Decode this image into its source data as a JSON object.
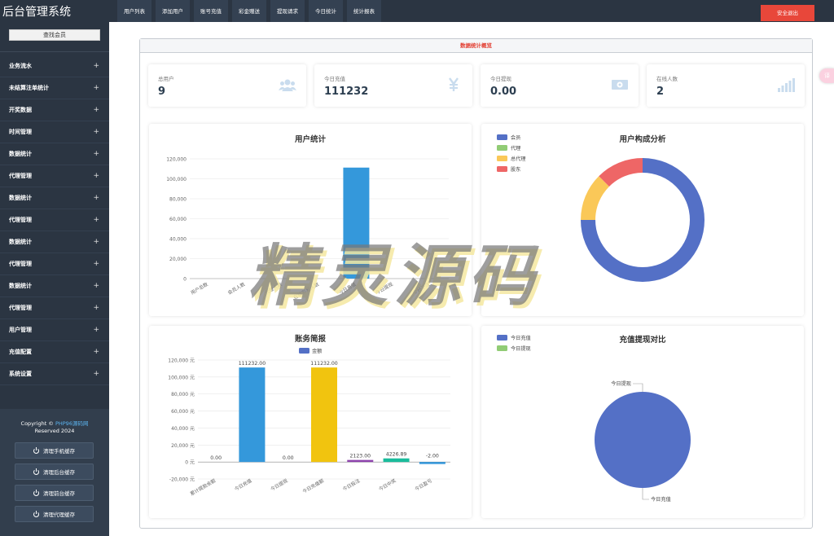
{
  "sidebar": {
    "brand": "后台管理系统",
    "search_label": "查找会员",
    "menu": [
      "业务流水",
      "未结算注单统计",
      "开奖数据",
      "时间管理",
      "数据统计",
      "代理管理",
      "数据统计",
      "代理管理",
      "数据统计",
      "代理管理",
      "数据统计",
      "代理管理",
      "用户管理",
      "充值配置",
      "系统设置"
    ],
    "menu_plus": "+",
    "copyright_prefix": "Copyright ©",
    "copyright_link": "PHP96源码网",
    "copyright_suffix": "Reserved 2024",
    "cache_buttons": [
      "清理手机缓存",
      "清理后台缓存",
      "清理前台缓存",
      "清理代理缓存"
    ]
  },
  "topbar": {
    "nav": [
      "用户列表",
      "添加用户",
      "账号充值",
      "彩金赠送",
      "提现请求",
      "今日统计",
      "统计报表"
    ],
    "logout": "安全退出"
  },
  "panel": {
    "title": "数据统计概览"
  },
  "stats": [
    {
      "label": "总用户",
      "value": "9",
      "icon": "users-icon"
    },
    {
      "label": "今日充值",
      "value": "111232",
      "icon": "yen-icon"
    },
    {
      "label": "今日提现",
      "value": "0.00",
      "icon": "money-icon"
    },
    {
      "label": "在线人数",
      "value": "2",
      "icon": "signal-icon"
    }
  ],
  "colors": {
    "blue": "#3498db",
    "indigo": "#5470c6",
    "green": "#91cc75",
    "yellow": "#fac858",
    "red": "#ee6666",
    "gold": "#f1c40f",
    "purple": "#8e44ad",
    "teal": "#1abc9c"
  },
  "chart_data": [
    {
      "type": "bar",
      "title": "用户统计",
      "categories": [
        "用户总数",
        "会员人数",
        "代理人数",
        "在线彩票人数",
        "今日充值",
        "今日提现",
        "今日下注"
      ],
      "values": [
        0,
        0,
        0,
        0,
        111232,
        0,
        0
      ],
      "ylim": [
        0,
        120000
      ],
      "yticks": [
        "0",
        "20,000",
        "40,000",
        "60,000",
        "80,000",
        "100,000",
        "120,000"
      ],
      "grid": true
    },
    {
      "type": "pie",
      "title": "用户构成分析",
      "legend_position": "top-left",
      "series": [
        {
          "name": "会员",
          "value": 6
        },
        {
          "name": "代理",
          "value": 0
        },
        {
          "name": "总代理",
          "value": 1
        },
        {
          "name": "股东",
          "value": 1
        }
      ]
    },
    {
      "type": "bar",
      "title": "账务简报",
      "legend": "金额",
      "legend_position": "top",
      "categories": [
        "累计提款余额",
        "今日充值",
        "今日提现",
        "今日充值额",
        "今日投注",
        "今日中奖",
        "今日盈亏"
      ],
      "values": [
        0,
        111232,
        0,
        111232,
        2123,
        4226.89,
        -2
      ],
      "labels": [
        "0.00",
        "111232.00",
        "0.00",
        "111232.00",
        "2123.00",
        "4226.89",
        "-2.00"
      ],
      "ylim": [
        -20000,
        120000
      ],
      "yticks": [
        "-20,000 元",
        "0 元",
        "20,000 元",
        "40,000 元",
        "60,000 元",
        "80,000 元",
        "100,000 元",
        "120,000 元"
      ],
      "grid": true
    },
    {
      "type": "pie",
      "title": "充值提现对比",
      "legend_position": "top-left",
      "series": [
        {
          "name": "今日充值",
          "value": 111232
        },
        {
          "name": "今日提现",
          "value": 0
        }
      ]
    }
  ],
  "side_tab": "译",
  "watermark": "精灵源码"
}
